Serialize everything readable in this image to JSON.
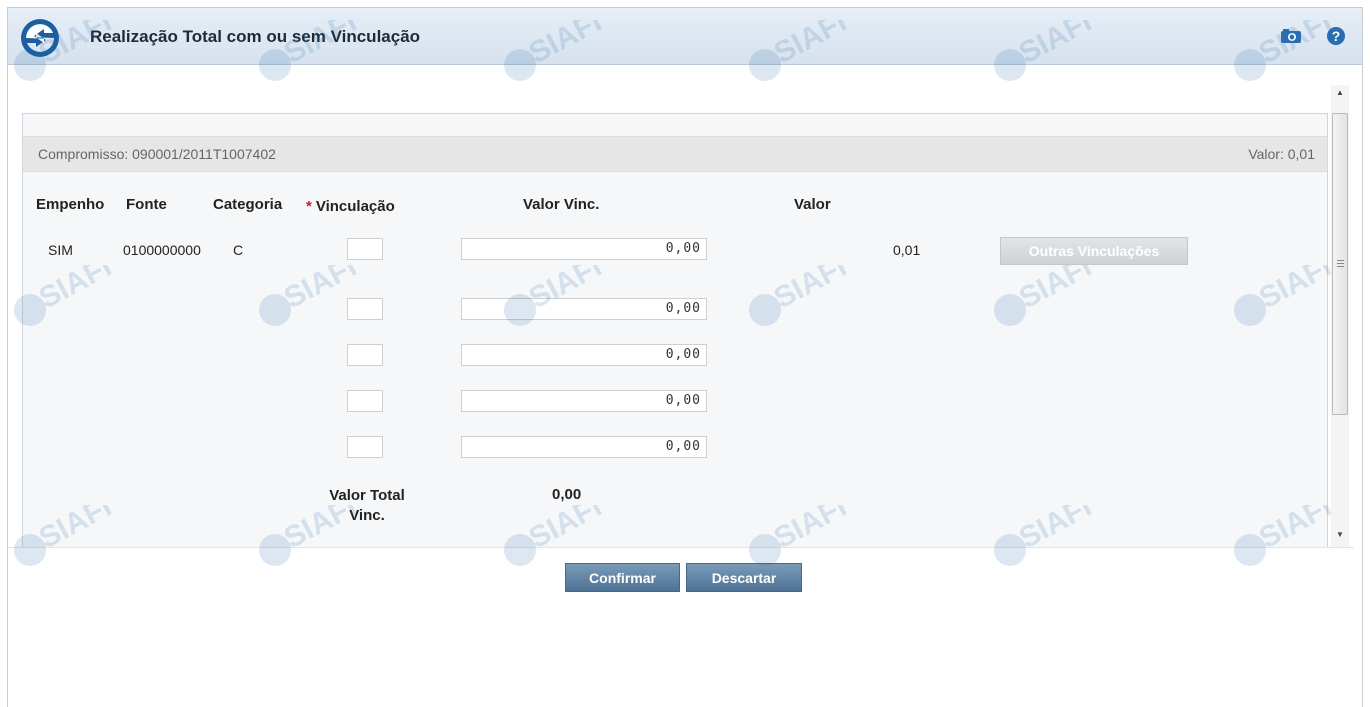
{
  "header": {
    "title": "Realização Total com ou sem Vinculação",
    "camera_icon": "camera-icon",
    "help_icon": "help-icon"
  },
  "panel": {
    "compromisso": "Compromisso: 090001/2011T1007402",
    "valor": "Valor: 0,01"
  },
  "table": {
    "headers": {
      "empenho": "Empenho",
      "fonte": "Fonte",
      "categoria": "Categoria",
      "required_mark": "*",
      "vinculacao": "Vinculação",
      "valor_vinc": "Valor Vinc.",
      "valor": "Valor"
    },
    "row": {
      "empenho": "SIM",
      "fonte": "0100000000",
      "categoria": "C",
      "valor": "0,01",
      "outras_button": "Outras Vinculações"
    },
    "vinculacoes": [
      {
        "codigo": "",
        "valor": "0,00"
      },
      {
        "codigo": "",
        "valor": "0,00"
      },
      {
        "codigo": "",
        "valor": "0,00"
      },
      {
        "codigo": "",
        "valor": "0,00"
      },
      {
        "codigo": "",
        "valor": "0,00"
      }
    ],
    "total_label": "Valor Total Vinc.",
    "total_value": "0,00"
  },
  "buttons": {
    "confirm": "Confirmar",
    "discard": "Descartar"
  },
  "colors": {
    "header_bg": "#dbe5f0",
    "button_blue": "#5a7ea1",
    "required": "#dd1122"
  },
  "watermark": "SIAFI"
}
